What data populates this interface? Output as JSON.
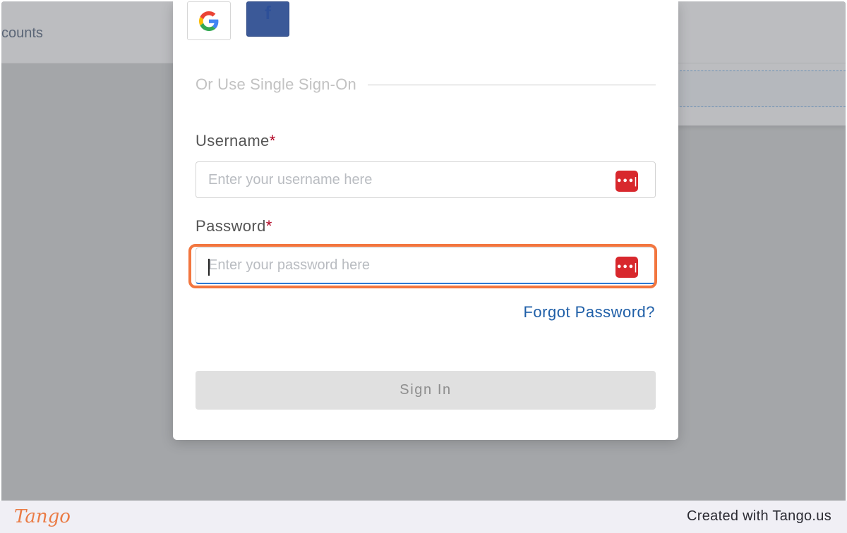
{
  "background": {
    "header_text": "counts"
  },
  "modal": {
    "social": {
      "google_label": "G",
      "facebook_label": "f"
    },
    "sso_divider_label": "Or Use Single Sign-On",
    "username": {
      "label": "Username",
      "required_mark": "*",
      "placeholder": "Enter your username here",
      "value": "",
      "password_manager_icon": "•••|"
    },
    "password": {
      "label": "Password",
      "required_mark": "*",
      "placeholder": "Enter your password here",
      "value": "",
      "password_manager_icon": "•••|"
    },
    "forgot_password_label": "Forgot Password?",
    "sign_in_label": "Sign In"
  },
  "footer": {
    "logo_text": "Tango",
    "created_with": "Created with Tango.us"
  },
  "colors": {
    "highlight": "#f2763f",
    "link": "#1f5fa8",
    "required": "#b00020",
    "password_manager": "#d8282d"
  }
}
